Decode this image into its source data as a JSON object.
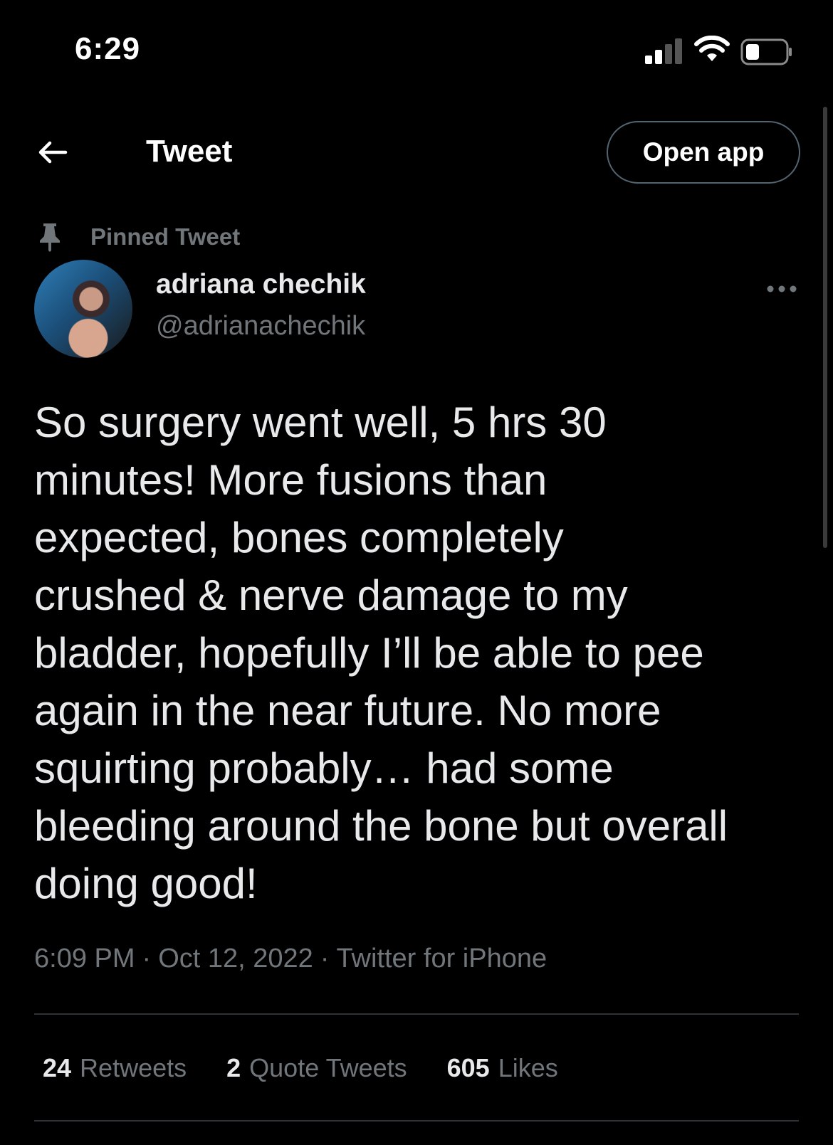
{
  "status_bar": {
    "time": "6:29",
    "icons": [
      "signal-icon",
      "wifi-icon",
      "battery-icon"
    ]
  },
  "header": {
    "title": "Tweet",
    "back_icon": "back-arrow-icon",
    "open_app_label": "Open app"
  },
  "tweet": {
    "pinned_label": "Pinned Tweet",
    "pinned_icon": "pin-icon",
    "author": {
      "name": "adriana chechik",
      "handle": "@adrianachechik"
    },
    "more_icon": "more-icon",
    "text": "So surgery went well, 5 hrs 30\nminutes! More fusions than\nexpected, bones completely\ncrushed & nerve damage to my\nbladder, hopefully I’ll be able to pee\nagain in the near future. No more\nsquirting probably… had some\nbleeding around the bone but overall\ndoing good!",
    "time": "6:09 PM",
    "date": "Oct 12, 2022",
    "source": "Twitter for iPhone",
    "separator": "·",
    "stats": {
      "retweets_count": "24",
      "retweets_label": "Retweets",
      "quotes_count": "2",
      "quotes_label": "Quote Tweets",
      "likes_count": "605",
      "likes_label": "Likes"
    }
  },
  "colors": {
    "background": "#000000",
    "text_primary": "#e7e9ea",
    "text_secondary": "#71767b",
    "divider": "#2f3336",
    "button_border": "#536471"
  }
}
